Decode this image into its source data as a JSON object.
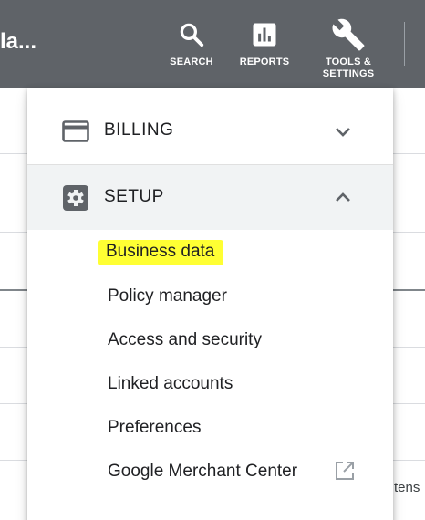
{
  "app_title": "la...",
  "toolbar": {
    "search_label": "SEARCH",
    "reports_label": "REPORTS",
    "tools_label": "TOOLS &\nSETTINGS"
  },
  "background": {
    "partial_text": "tens"
  },
  "menu": {
    "billing": {
      "title": "BILLING",
      "expanded": false,
      "icon": "credit-card-icon"
    },
    "setup": {
      "title": "SETUP",
      "expanded": true,
      "icon": "gear-icon",
      "items": [
        {
          "label": "Business data",
          "highlighted": true
        },
        {
          "label": "Policy manager"
        },
        {
          "label": "Access and security"
        },
        {
          "label": "Linked accounts"
        },
        {
          "label": "Preferences"
        },
        {
          "label": "Google Merchant Center",
          "icon": "external-link-icon"
        }
      ]
    }
  },
  "colors": {
    "topbar": "#5f6368",
    "highlight": "#ffff33",
    "expanded_header_bg": "#f1f3f4",
    "icon_gray": "#5f6368"
  }
}
